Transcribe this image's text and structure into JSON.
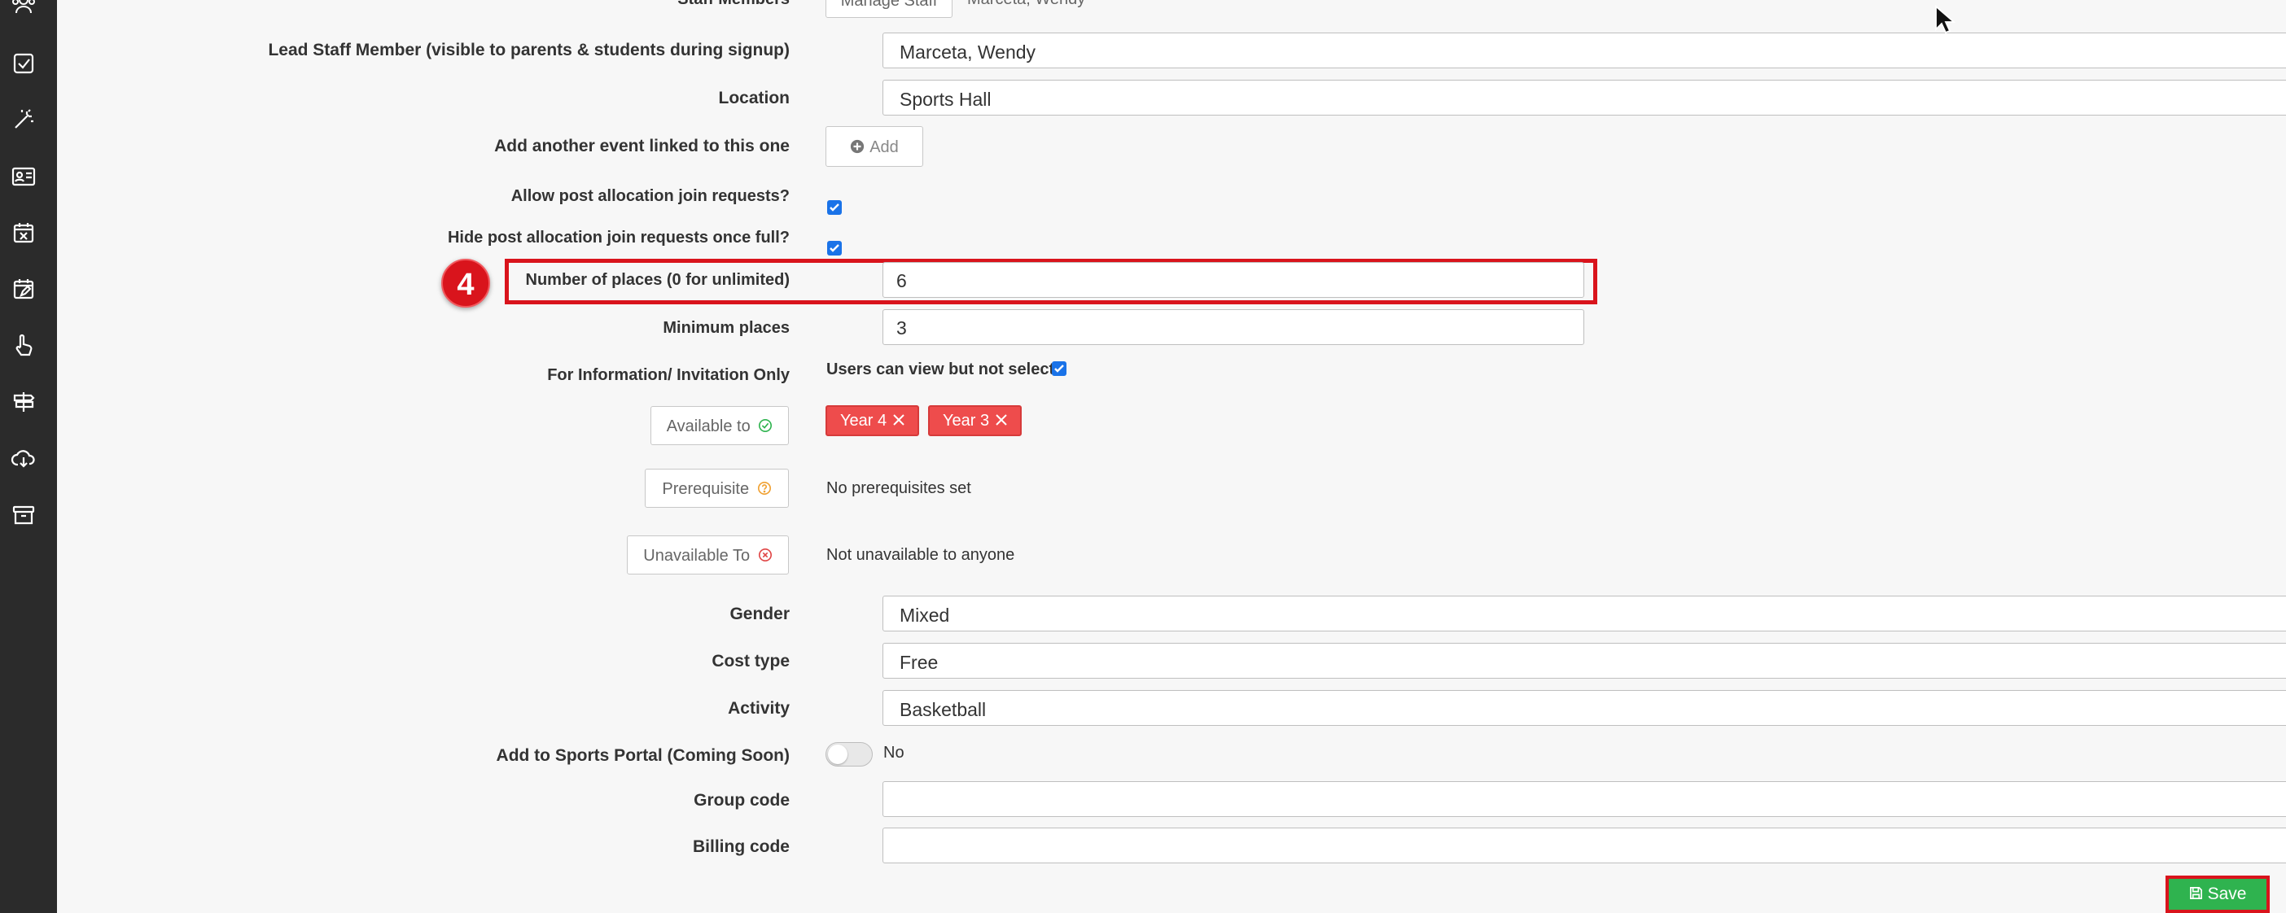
{
  "form": {
    "staff_members": {
      "label": "Staff Members",
      "button": "Manage Staff",
      "value": "Marceta, Wendy"
    },
    "lead_staff": {
      "label": "Lead Staff Member (visible to parents & students during signup)",
      "value": "Marceta, Wendy"
    },
    "location": {
      "label": "Location",
      "value": "Sports Hall"
    },
    "linked_event": {
      "label": "Add another event linked to this one",
      "button": "Add"
    },
    "allow_join": {
      "label": "Allow post allocation join requests?",
      "checked": true
    },
    "hide_join": {
      "label": "Hide post allocation join requests once full?",
      "checked": true
    },
    "places": {
      "label": "Number of places (0 for unlimited)",
      "value": "6"
    },
    "min_places": {
      "label": "Minimum places",
      "value": "3"
    },
    "info_only": {
      "label": "For Information/ Invitation Only",
      "text": "Users can view but not select",
      "checked": true
    },
    "available_to": {
      "button": "Available to",
      "tags": [
        "Year 4",
        "Year 3"
      ]
    },
    "prerequisite": {
      "button": "Prerequisite",
      "text": "No prerequisites set"
    },
    "unavailable_to": {
      "button": "Unavailable To",
      "text": "Not unavailable to anyone"
    },
    "gender": {
      "label": "Gender",
      "value": "Mixed"
    },
    "cost_type": {
      "label": "Cost type",
      "value": "Free"
    },
    "activity": {
      "label": "Activity",
      "value": "Basketball"
    },
    "sports_portal": {
      "label": "Add to Sports Portal (Coming Soon)",
      "toggle_text": "No",
      "on": false
    },
    "group_code": {
      "label": "Group code",
      "value": ""
    },
    "billing_code": {
      "label": "Billing code",
      "value": ""
    },
    "save": "Save"
  },
  "annotation": {
    "step": "4"
  },
  "colors": {
    "sidebar": "#2b2b2b",
    "annotation": "#d9141c",
    "tag": "#ee4c4c",
    "save": "#2fb34f",
    "checkbox": "#1a73e8"
  },
  "icons": [
    "users-icon",
    "checkbox-icon",
    "magic-wand-icon",
    "id-card-icon",
    "calendar-x-icon",
    "calendar-edit-icon",
    "hand-pointer-icon",
    "signpost-icon",
    "cloud-download-icon",
    "archive-icon",
    "check-circle-icon",
    "question-circle-icon",
    "x-circle-icon",
    "plus-circle-icon",
    "save-icon",
    "mouse-cursor-icon"
  ]
}
